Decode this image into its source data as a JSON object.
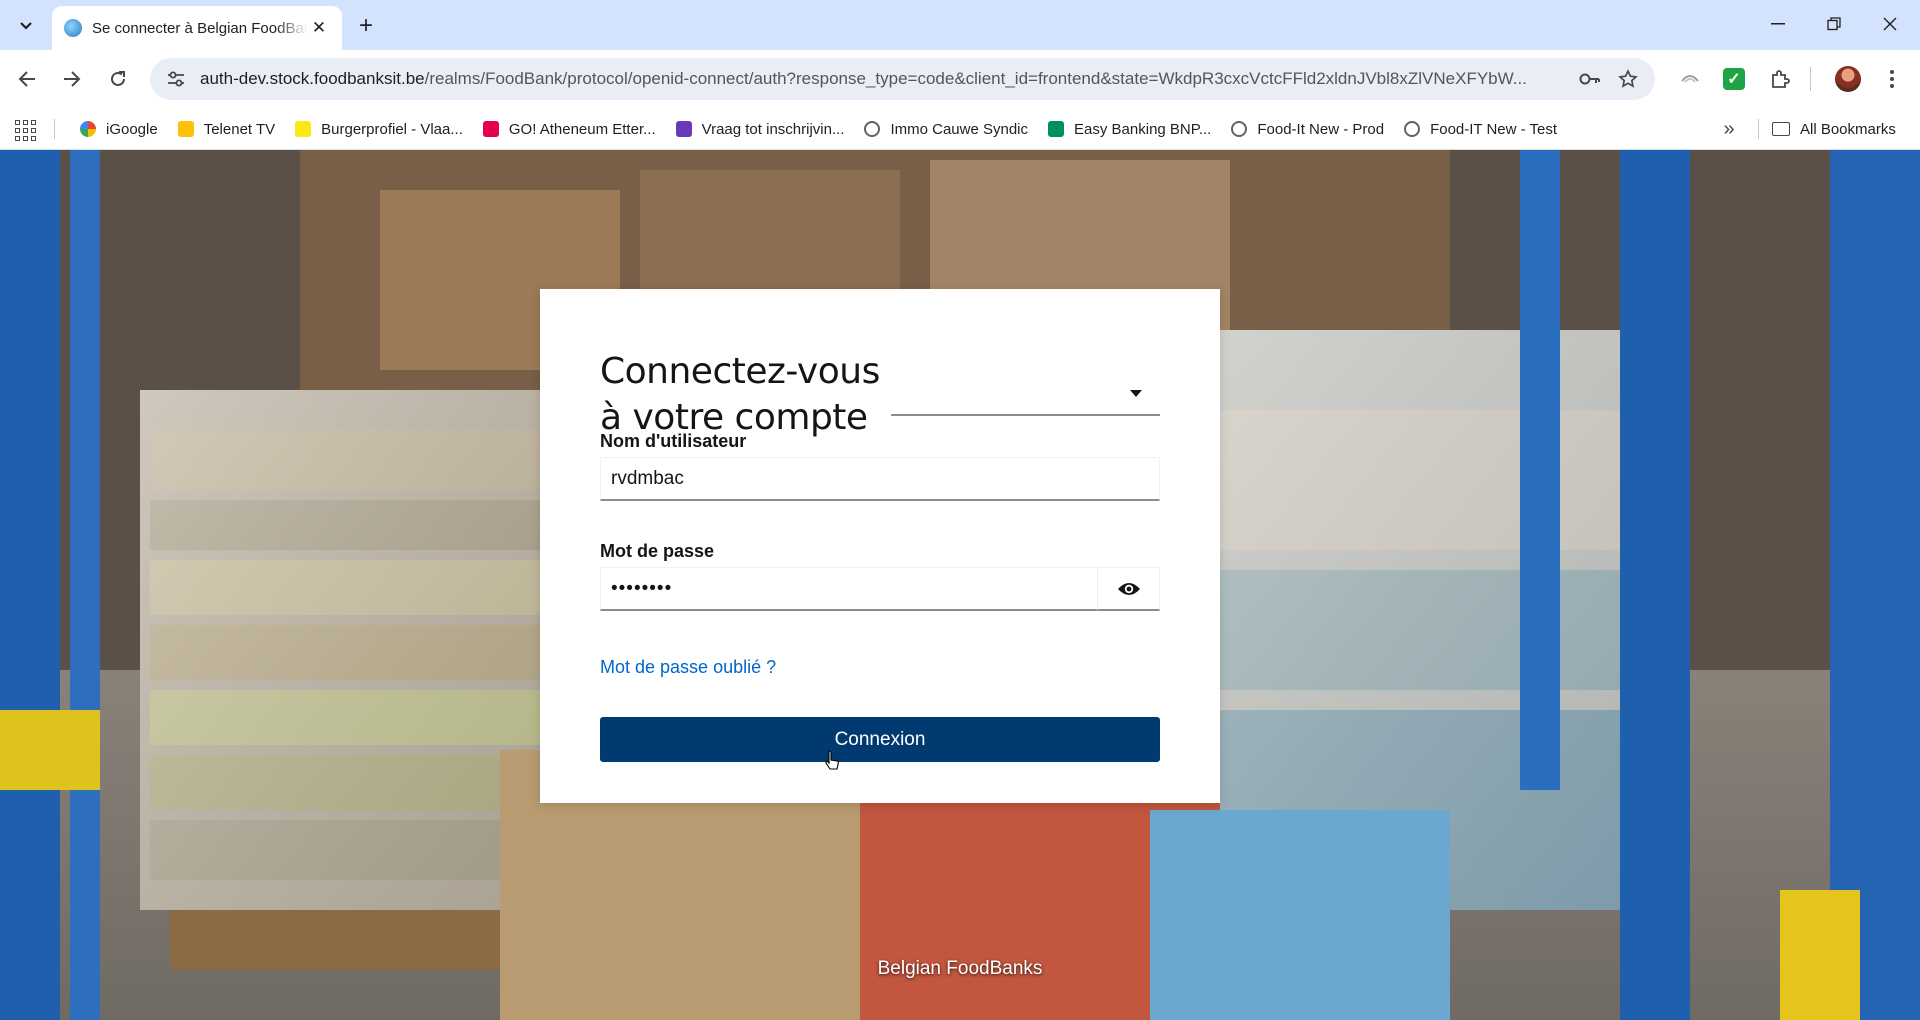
{
  "browser": {
    "tab": {
      "title": "Se connecter à Belgian FoodBanks"
    },
    "url": {
      "host": "auth-dev.stock.foodbanksit.be",
      "path": "/realms/FoodBank/protocol/openid-connect/auth?response_type=code&client_id=frontend&state=WkdpR3cxcVctcFFld2xldnJVbl8xZlVNeXFYbW..."
    },
    "bookmarks": [
      {
        "label": "iGoogle",
        "icon": "google-icon",
        "color": "#4285f4"
      },
      {
        "label": "Telenet TV",
        "icon": "telenet-icon",
        "color": "#ffc107"
      },
      {
        "label": "Burgerprofiel - Vlaa...",
        "icon": "vlaanderen-icon",
        "color": "#ffe615"
      },
      {
        "label": "GO! Atheneum Etter...",
        "icon": "go-icon",
        "color": "#e5004f"
      },
      {
        "label": "Vraag tot inschrijvin...",
        "icon": "form-icon",
        "color": "#673ab7"
      },
      {
        "label": "Immo Cauwe Syndic",
        "icon": "globe-icon",
        "color": "#5f6368"
      },
      {
        "label": "Easy Banking  BNP...",
        "icon": "bnp-icon",
        "color": "#00915a"
      },
      {
        "label": "Food-It New - Prod",
        "icon": "globe-icon",
        "color": "#5f6368"
      },
      {
        "label": "Food-IT New - Test",
        "icon": "globe-icon",
        "color": "#5f6368"
      }
    ],
    "all_bookmarks": "All Bookmarks"
  },
  "login": {
    "heading": "Connectez-vous à votre compte",
    "locale_value": "",
    "username_label": "Nom d'utilisateur",
    "username_value": "rvdmbac",
    "password_label": "Mot de passe",
    "password_value": "••••••••",
    "forgot_password": "Mot de passe oublié ?",
    "submit": "Connexion",
    "accent": "#003a70",
    "link_color": "#0066cc"
  },
  "footer": {
    "brand": "Belgian FoodBanks"
  }
}
